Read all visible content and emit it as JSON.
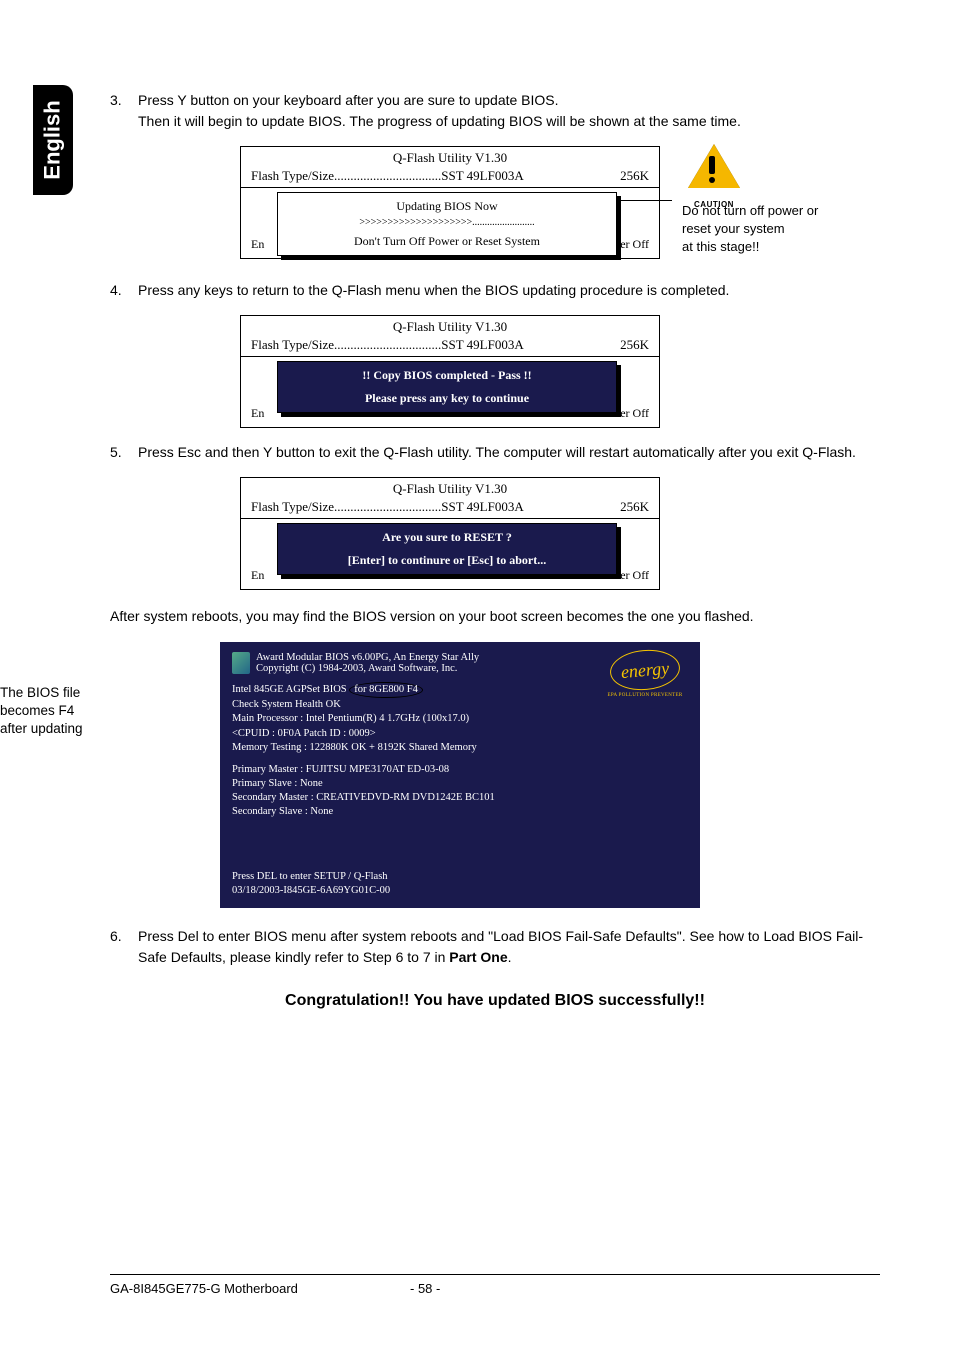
{
  "sideTab": "English",
  "steps": {
    "s3": {
      "num": "3.",
      "line1": "Press Y button on your keyboard after you are sure to update BIOS.",
      "line2": "Then it will begin to update BIOS. The progress of updating BIOS will be shown at the same time."
    },
    "s4": {
      "num": "4.",
      "text": "Press any keys to return to the Q-Flash menu when the BIOS updating procedure is completed."
    },
    "s5": {
      "num": "5.",
      "text": "Press Esc and then Y button to exit the Q-Flash utility. The computer will restart automatically after you exit Q-Flash."
    },
    "afterReboot": "After system reboots, you may find the BIOS version on your boot screen becomes the one you flashed.",
    "s6": {
      "num": "6.",
      "line1": "Press Del to enter BIOS menu after system reboots and \"Load BIOS Fail-Safe Defaults\". See how to Load BIOS Fail-Safe Defaults, please kindly refer to Step 6 to 7 in ",
      "bold": "Part One",
      "after": "."
    }
  },
  "qflash": {
    "title": "Q-Flash Utility V1.30",
    "flashLine": "Flash Type/Size.................................SST 49LF003A",
    "size": "256K",
    "footerLeftPartial": "En",
    "footerRightPartial": "er Off"
  },
  "dialog1": {
    "line1": "Updating BIOS Now",
    "line2": ">>>>>>>>>>>>>>>>>>>>.........................",
    "warn": "Don't Turn Off Power or Reset System"
  },
  "dialog2": {
    "line1": "!! Copy BIOS completed - Pass !!",
    "line2": "Please press any key to continue"
  },
  "dialog3": {
    "line1": "Are you sure to RESET ?",
    "line2": "[Enter] to continure or [Esc] to abort..."
  },
  "caution": {
    "label": "CAUTION",
    "text1": "Do not turn off power or",
    "text2": "reset your system",
    "text3": "at this stage!!"
  },
  "boot": {
    "hdr1": "Award Modular BIOS v6.00PG, An Energy Star Ally",
    "hdr2": "Copyright  (C) 1984-2003, Award Software,  Inc.",
    "l1a": "Intel 845GE AGPSet BIOS ",
    "l1b": "for 8GE800 F4",
    "l2": "Check System Health OK",
    "l3": "Main Processor : Intel Pentium(R) 4  1.7GHz (100x17.0)",
    "l4": "<CPUID : 0F0A Patch ID  : 0009>",
    "l5": "Memory Testing   : 122880K OK + 8192K Shared Memory",
    "l6": "Primary Master : FUJITSU MPE3170AT ED-03-08",
    "l7": "Primary Slave : None",
    "l8": "Secondary Master : CREATIVEDVD-RM DVD1242E BC101",
    "l9": "Secondary Slave : None",
    "f1": "Press DEL to enter SETUP / Q-Flash",
    "f2": "03/18/2003-I845GE-6A69YG01C-00",
    "energy": "energy",
    "energySub": "EPA  POLLUTION PREVENTER",
    "callout": "The BIOS file becomes F4 after updating"
  },
  "congrats": "Congratulation!! You have updated BIOS successfully!!",
  "footer": {
    "left": "GA-8I845GE775-G Motherboard",
    "center": "- 58 -"
  }
}
